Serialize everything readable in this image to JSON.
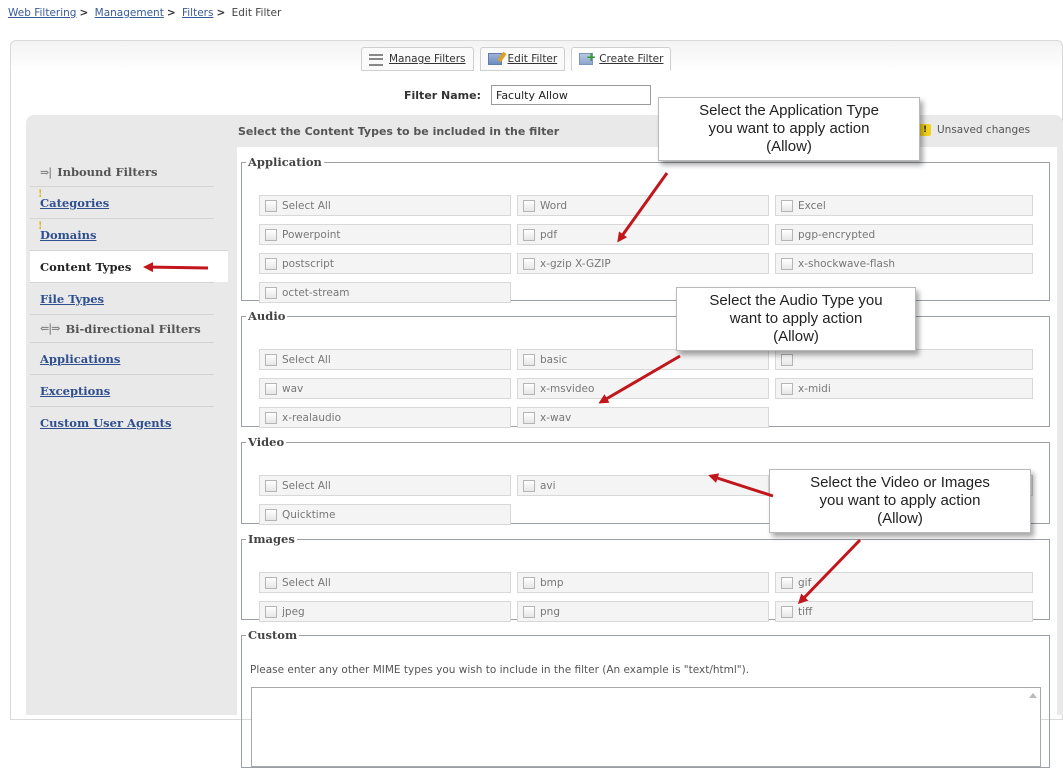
{
  "breadcrumb": {
    "items": [
      "Web Filtering",
      "Management",
      "Filters"
    ],
    "current": "Edit Filter"
  },
  "tabs": [
    {
      "label": "Manage Filters",
      "icon": "list-icon"
    },
    {
      "label": "Edit Filter",
      "icon": "edit-icon"
    },
    {
      "label": "Create Filter",
      "icon": "create-icon"
    }
  ],
  "filter_name": {
    "label": "Filter Name:",
    "value": "Faculty Allow"
  },
  "content_header": "Select the Content Types to be included in the filter",
  "unsaved": {
    "icon": "warning-icon",
    "text": "Unsaved changes"
  },
  "sidebar": {
    "inbound_heading": "Inbound Filters",
    "inbound_items": [
      {
        "label": "Categories",
        "warn": true
      },
      {
        "label": "Domains",
        "warn": true
      },
      {
        "label": "Content Types",
        "selected": true
      },
      {
        "label": "File Types"
      }
    ],
    "bidir_heading": "Bi-directional Filters",
    "bidir_items": [
      {
        "label": "Applications"
      },
      {
        "label": "Exceptions"
      },
      {
        "label": "Custom User Agents"
      }
    ]
  },
  "groups": {
    "application": {
      "legend": "Application",
      "options": [
        "Select All",
        "Word",
        "Excel",
        "Powerpoint",
        "pdf",
        "pgp-encrypted",
        "postscript",
        "x-gzip X-GZIP",
        "x-shockwave-flash",
        "octet-stream"
      ]
    },
    "audio": {
      "legend": "Audio",
      "options": [
        "Select All",
        "basic",
        "",
        "wav",
        "x-msvideo",
        "x-midi",
        "x-realaudio",
        "x-wav"
      ]
    },
    "video": {
      "legend": "Video",
      "options": [
        "Select All",
        "avi",
        "",
        "Quicktime"
      ]
    },
    "images": {
      "legend": "Images",
      "options": [
        "Select All",
        "bmp",
        "gif",
        "jpeg",
        "png",
        "tiff"
      ]
    },
    "custom": {
      "legend": "Custom",
      "text": "Please enter any other MIME types you wish to include in the filter (An example is \"text/html\")."
    }
  },
  "callouts": {
    "application": [
      "Select the Application Type",
      "you want to apply action",
      "(Allow)"
    ],
    "audio": [
      "Select the Audio Type you",
      "want to apply action",
      "(Allow)"
    ],
    "video": [
      "Select the Video or Images",
      "you want to apply action",
      "(Allow)"
    ]
  },
  "colors": {
    "link": "#2f4f8f",
    "annotation_arrow": "#c0161c",
    "warning": "#f3d21c"
  }
}
